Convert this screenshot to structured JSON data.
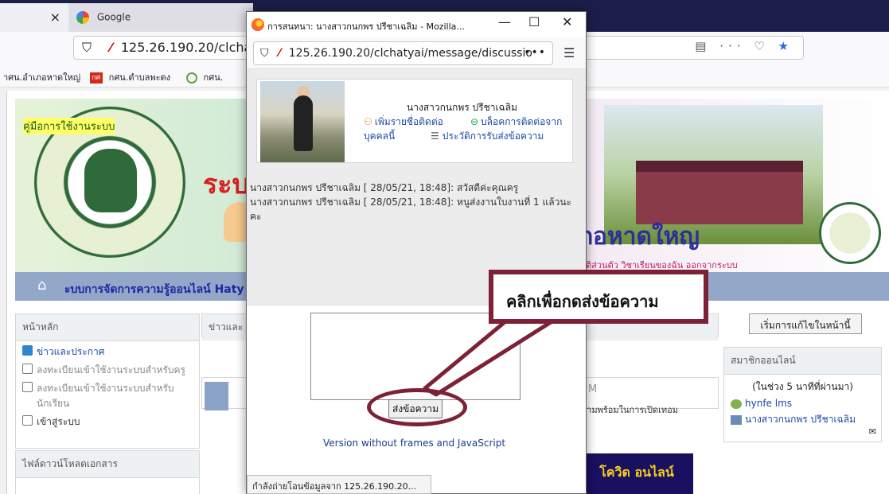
{
  "bg_browser": {
    "tab_partial_close": "×",
    "tab_google_title": "Google",
    "url": "125.26.190.20/clchatyai",
    "url_icons": "▤ ··· ♡",
    "star": "★",
    "bookmarks": {
      "item1": "าศน.อำเภอหาดใหญ่",
      "item2_ico": "กศ",
      "item2": "กศน.ตำบลพะตง",
      "item3": "กศน."
    }
  },
  "site": {
    "banner_text_left": "ระบ",
    "banner_text_right": "น.อำเภอหาดใหญ",
    "banner_links": "ลทประวัติส่วนตัว  วิชาเรียนของฉัน  ออกจากระบบ",
    "nav_home": "⌂",
    "nav_title": "ะบบการจัดการความรู้ออนไลน์ Haty",
    "left_block": {
      "header": "หน้าหลัก",
      "items": [
        "ข่าวและประกาศ",
        "ลงทะเบียนเข้าใช้งานระบบสำหรับครู",
        "ลงทะเบียนเข้าใช้งานระบบสำหรับนักเรียน",
        "เข้าสู่ระบบ"
      ]
    },
    "news_header": "ข่าวและ",
    "news_M": "M",
    "news_snippet": "วามพร้อมในการเปิดเทอม",
    "downloads_header": "ไฟล์ดาวน์โหลดเอกสาร",
    "downloads_item": "คู่มือการใช้งานระบบ",
    "promo_text": "โควิด\nอนไลน์",
    "edit_button": "เริ่มการแก้ไขในหน้านี้",
    "online_block": {
      "header": "สมาชิกออนไลน์",
      "subtitle": "(ในช่วง 5 นาทีที่ผ่านมา)",
      "users": [
        "hynfe lms",
        "นางสาวกนกพร ปรีชาเฉลิม"
      ],
      "mail_icon": "✉"
    }
  },
  "popup": {
    "title": "การสนทนา: นางสาวกนกพร ปรีชาเฉลิม - Mozilla...",
    "min": "—",
    "max": "☐",
    "close": "✕",
    "url": "125.26.190.20/clchatyai/message/discussio",
    "url_dots": "•••",
    "menu": "☰",
    "profile": {
      "name": "นางสาวกนกพร ปรีชาเฉลิม",
      "add_contact": "เพิ่มรายชื่อติดต่อ",
      "block_contact": "บล็อคการติดต่อจาก",
      "block_contact2": "บุคคลนี้",
      "history": "ประวัติการรับส่งข้อความ"
    },
    "messages": [
      "นางสาวกนกพร ปรีชาเฉลิม [ 28/05/21, 18:48]: สวัสดีค่ะคุณครู",
      "นางสาวกนกพร ปรีชาเฉลิม [ 28/05/21, 18:48]: หนูส่งงานใบงานที่ 1 แล้วนะคะ"
    ],
    "send_button": "ส่งข้อความ",
    "no_frames_link": "Version without frames and JavaScript",
    "status": "กำลังถ่ายโอนข้อมูลจาก 125.26.190.20..."
  },
  "annotation": {
    "callout_text": "คลิกเพื่อกดส่งข้อความ",
    "color": "#7d2137"
  }
}
